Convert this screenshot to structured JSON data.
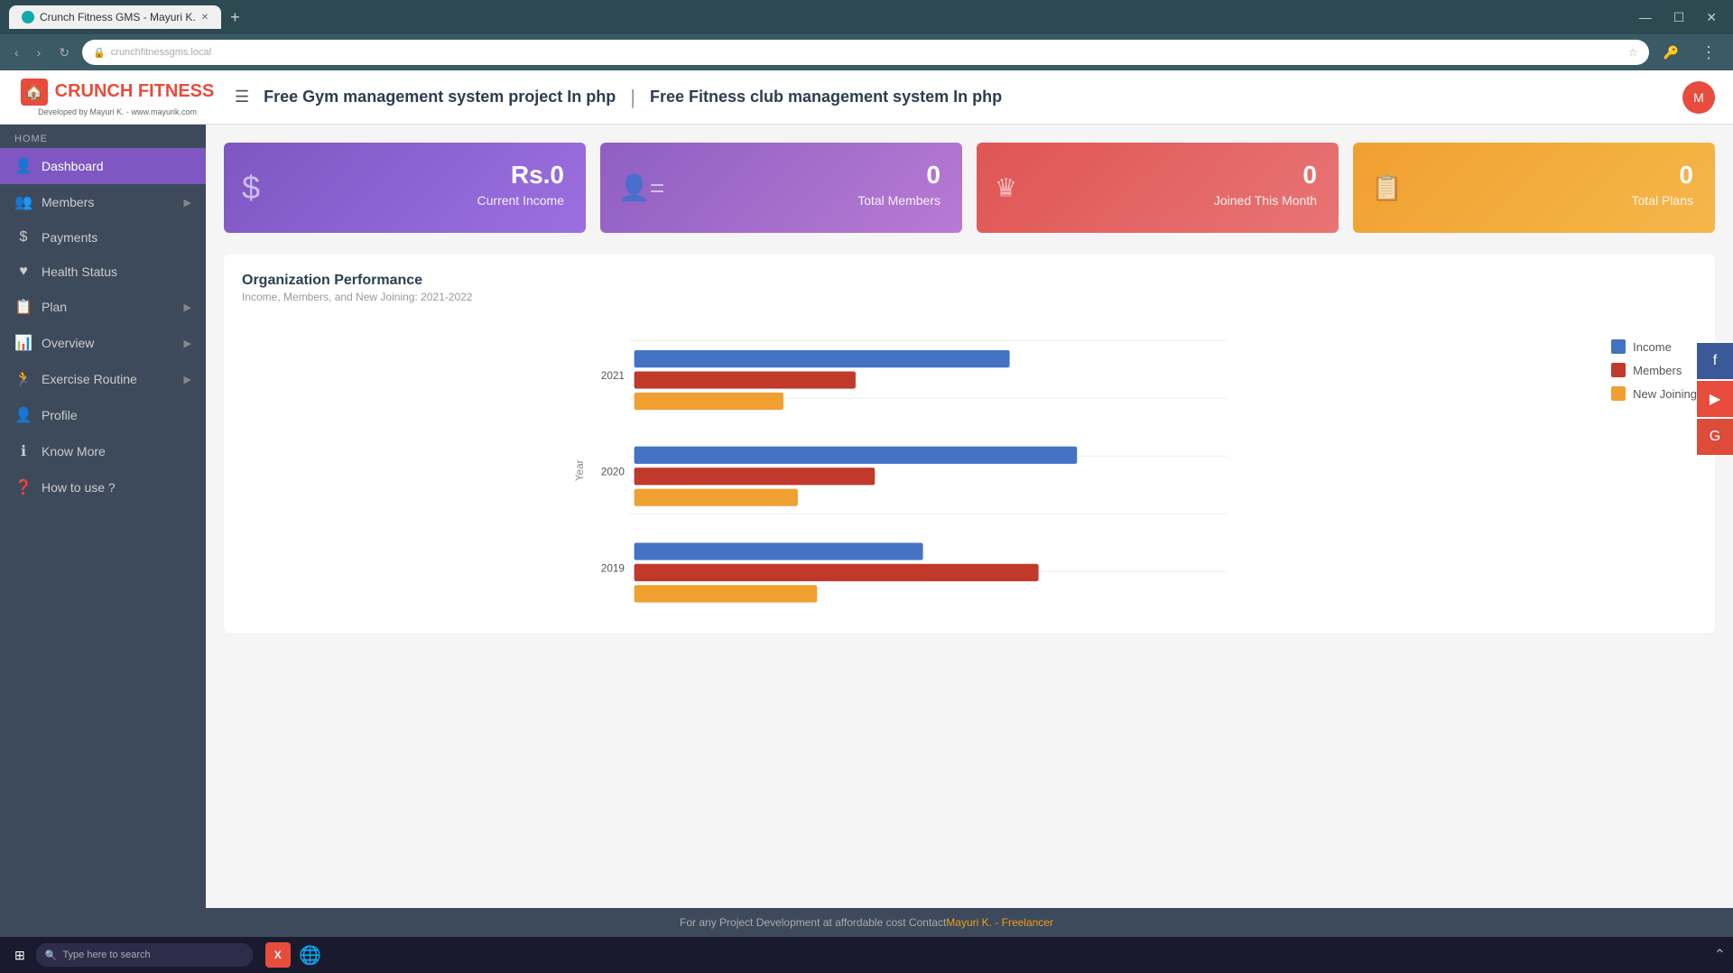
{
  "browser": {
    "tab_title": "Crunch Fitness GMS - Mayuri K.",
    "url": "",
    "new_tab_symbol": "+",
    "nav_back": "‹",
    "nav_forward": "›",
    "nav_reload": "↻",
    "lock_icon": "🔒",
    "star_icon": "☆",
    "key_icon": "🔑",
    "menu_icon": "⋮"
  },
  "header": {
    "logo_text1": "CRUNCH",
    "logo_text2": "FITNESS",
    "logo_sub": "Developed by Mayuri K. - www.mayurik.com",
    "title1": "Free Gym management system project In php",
    "divider": "|",
    "title2": "Free Fitness club management system In php",
    "hamburger": "☰"
  },
  "sidebar": {
    "home_label": "HOME",
    "items": [
      {
        "id": "dashboard",
        "label": "Dashboard",
        "icon": "👤",
        "active": true,
        "arrow": false
      },
      {
        "id": "members",
        "label": "Members",
        "icon": "👥",
        "active": false,
        "arrow": true
      },
      {
        "id": "payments",
        "label": "Payments",
        "icon": "$",
        "active": false,
        "arrow": false
      },
      {
        "id": "health-status",
        "label": "Health Status",
        "icon": "♥",
        "active": false,
        "arrow": false
      },
      {
        "id": "plan",
        "label": "Plan",
        "icon": "📋",
        "active": false,
        "arrow": true
      },
      {
        "id": "overview",
        "label": "Overview",
        "icon": "📊",
        "active": false,
        "arrow": true
      },
      {
        "id": "exercise-routine",
        "label": "Exercise Routine",
        "icon": "🏃",
        "active": false,
        "arrow": true
      },
      {
        "id": "profile",
        "label": "Profile",
        "icon": "👤",
        "active": false,
        "arrow": false
      },
      {
        "id": "know-more",
        "label": "Know More",
        "icon": "ℹ",
        "active": false,
        "arrow": false
      },
      {
        "id": "how-to-use",
        "label": "How to use ?",
        "icon": "❓",
        "active": false,
        "arrow": false
      }
    ]
  },
  "stat_cards": [
    {
      "id": "current-income",
      "icon": "$",
      "value": "Rs.0",
      "label": "Current Income",
      "color": "purple"
    },
    {
      "id": "total-members",
      "icon": "👤",
      "value": "0",
      "label": "Total Members",
      "color": "violet"
    },
    {
      "id": "joined-this-month",
      "icon": "♛",
      "value": "0",
      "label": "Joined This Month",
      "color": "red"
    },
    {
      "id": "total-plans",
      "icon": "📋",
      "value": "0",
      "label": "Total Plans",
      "color": "orange"
    }
  ],
  "chart": {
    "title": "Organization Performance",
    "subtitle": "Income, Members, and New Joining: 2021-2022",
    "years": [
      "2021",
      "2020",
      "2019"
    ],
    "legend": [
      {
        "label": "Income",
        "color": "#4472c4"
      },
      {
        "label": "Members",
        "color": "#c0392b"
      },
      {
        "label": "New Joining",
        "color": "#f0a030"
      }
    ],
    "bars": {
      "2021": {
        "income": 75,
        "members": 40,
        "newjoining": 28
      },
      "2020": {
        "income": 88,
        "members": 45,
        "newjoining": 32
      },
      "2019": {
        "income": 55,
        "members": 72,
        "newjoining": 32
      }
    }
  },
  "footer": {
    "text1": "For any Project Development at affordable cost Contact ",
    "link_text": "Mayuri K. - Freelancer",
    "link_url": "#"
  },
  "social": [
    {
      "id": "facebook",
      "icon": "f",
      "class": "fb"
    },
    {
      "id": "youtube",
      "icon": "▶",
      "class": "yt"
    },
    {
      "id": "google",
      "icon": "G",
      "class": "gp"
    }
  ],
  "taskbar": {
    "start_icon": "⊞",
    "search_placeholder": "Type here to search",
    "chevron": "⌃"
  }
}
